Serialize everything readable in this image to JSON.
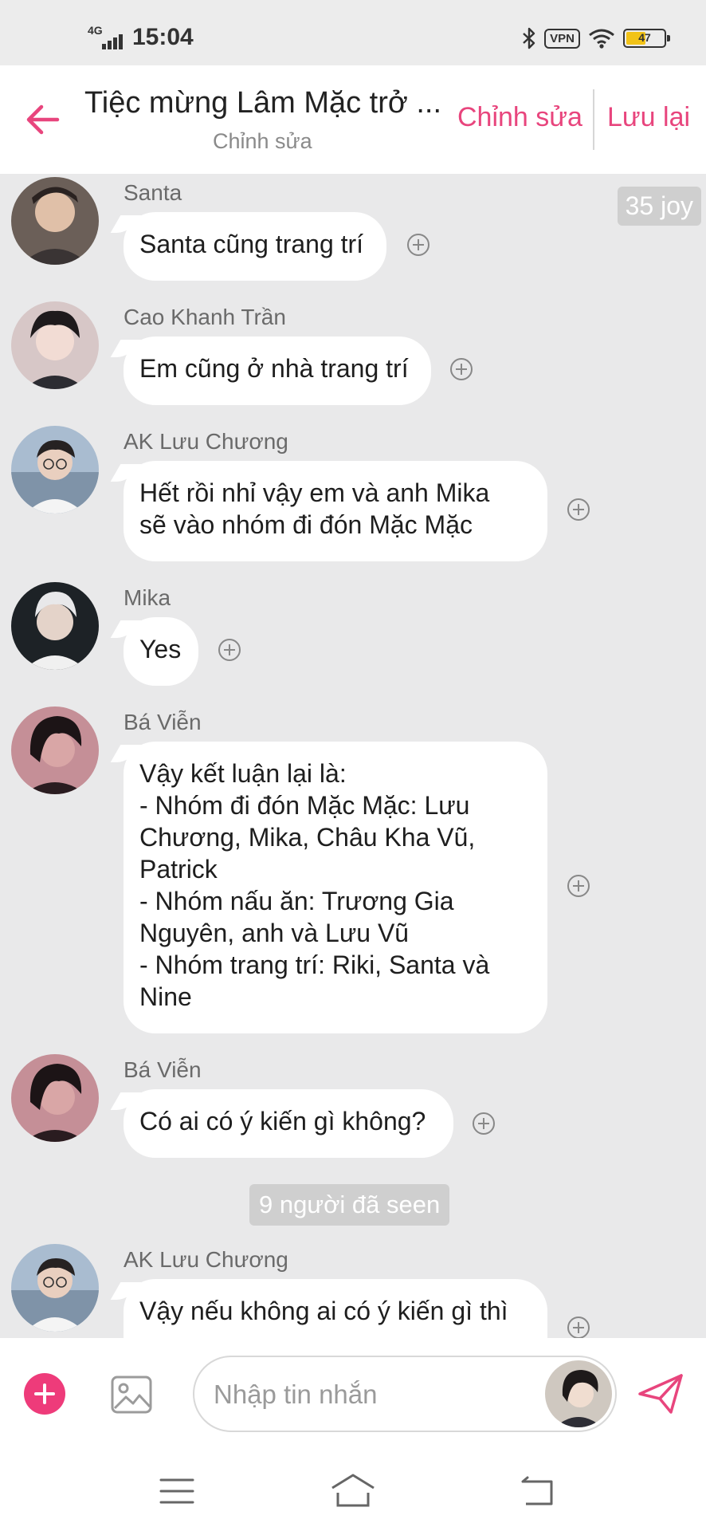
{
  "status_bar": {
    "network": "4G",
    "time": "15:04",
    "vpn_label": "VPN",
    "battery": "47"
  },
  "header": {
    "title": "Tiệc mừng Lâm Mặc trở ...",
    "subtitle": "Chỉnh sửa",
    "edit_label": "Chỉnh sửa",
    "save_label": "Lưu lại"
  },
  "chat": {
    "joy_badge": "35 joy",
    "seen_text": "9 người đã seen",
    "messages": [
      {
        "sender": "Santa",
        "lines": [
          "Santa cũng trang trí"
        ]
      },
      {
        "sender": "Cao Khanh Trần",
        "lines": [
          "Em cũng ở nhà trang trí"
        ]
      },
      {
        "sender": "AK Lưu Chương",
        "lines": [
          "Hết rồi nhỉ vậy em và anh Mika",
          "sẽ vào nhóm đi đón Mặc Mặc"
        ]
      },
      {
        "sender": "Mika",
        "lines": [
          "Yes"
        ]
      },
      {
        "sender": "Bá Viễn",
        "lines": [
          "Vậy kết luận lại là:",
          "- Nhóm đi đón Mặc Mặc: Lưu",
          "Chương, Mika, Châu Kha Vũ,",
          "Patrick",
          "- Nhóm nấu ăn: Trương Gia",
          "Nguyên, anh và Lưu Vũ",
          "- Nhóm trang trí: Riki, Santa và",
          "Nine"
        ]
      },
      {
        "sender": "Bá Viễn",
        "lines": [
          "Có ai có ý kiến gì không?"
        ]
      },
      {
        "sender": "AK Lưu Chương",
        "lines": [
          "Vậy nếu không ai có ý kiến gì thì"
        ]
      }
    ]
  },
  "input": {
    "placeholder": "Nhập tin nhắn"
  },
  "colors": {
    "accent": "#e8457d",
    "add_button": "#ee3b7a",
    "chat_bg": "#e9e9ea",
    "bubble": "#ffffff"
  },
  "icons": [
    "back-arrow-icon",
    "add-reaction-icon",
    "add-icon",
    "image-icon",
    "send-icon",
    "menu-icon",
    "home-icon",
    "back-icon",
    "bluetooth-icon",
    "wifi-icon",
    "battery-icon",
    "signal-icon"
  ]
}
